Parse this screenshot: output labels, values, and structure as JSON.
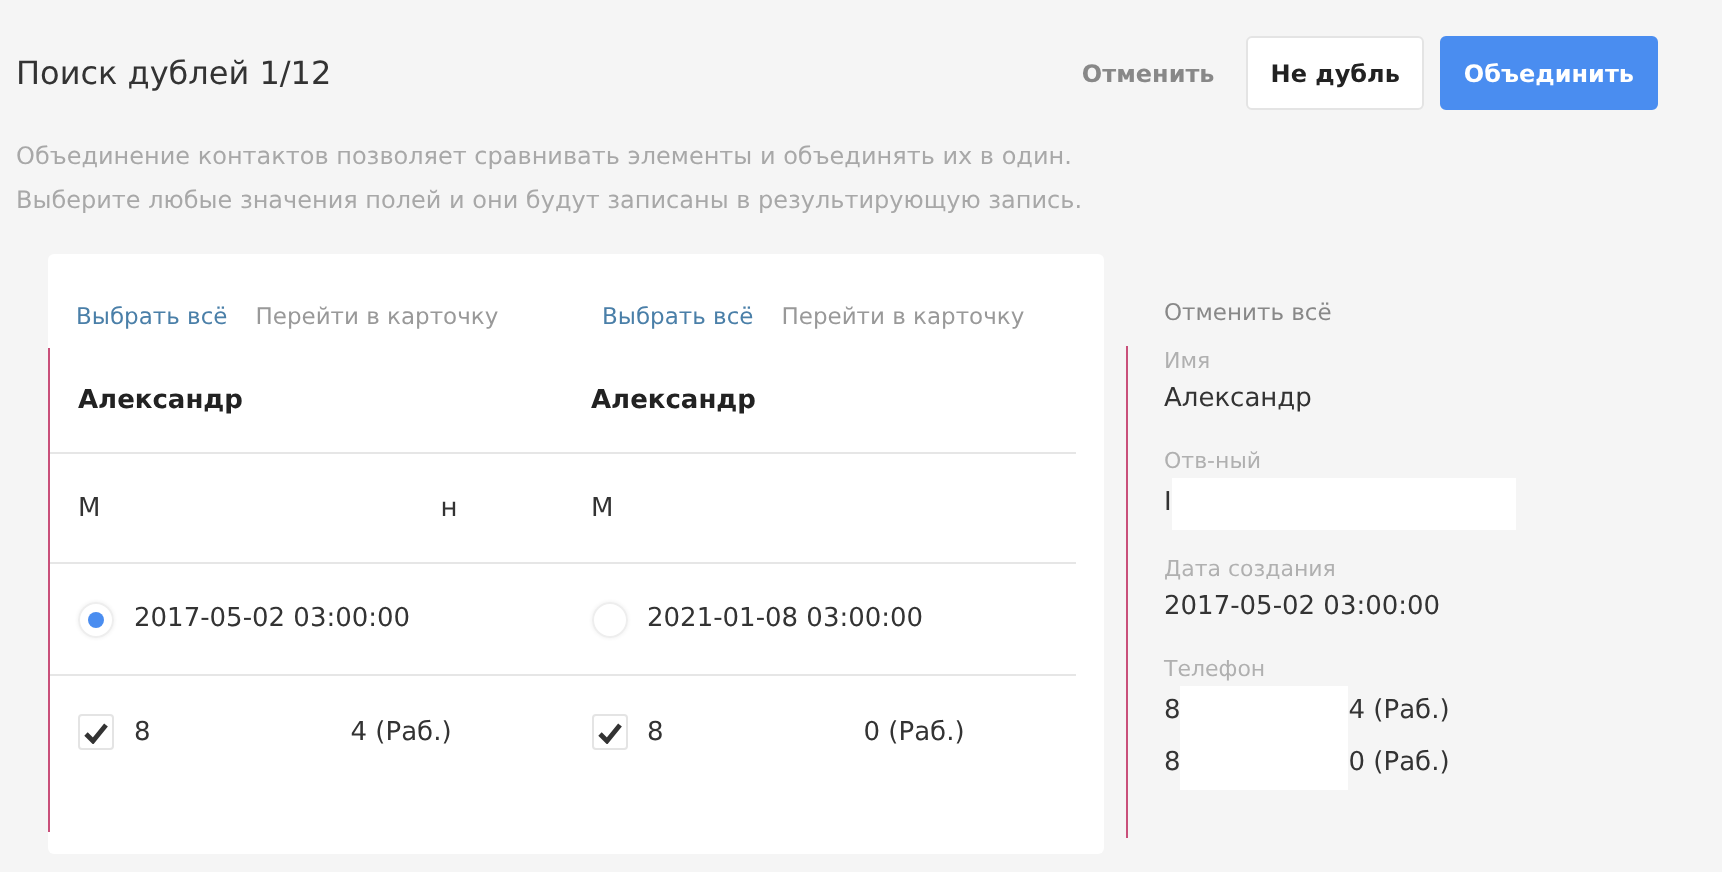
{
  "header": {
    "title": "Поиск дублей 1/12",
    "buttons": [
      {
        "label": "Отменить",
        "kind": "text"
      },
      {
        "label": "Не дубль",
        "kind": "secondary"
      },
      {
        "label": "Объединить",
        "kind": "primary"
      }
    ]
  },
  "description": [
    "Объединение контактов позволяет сравнивать элементы и объединять их в один.",
    "Выберите любые значения полей и они будут записаны в результирующую запись."
  ],
  "contacts": [
    {
      "select_all": "Выбрать всё",
      "open_card": "Перейти в карточку",
      "name": "Александр",
      "responsible": {
        "start": "М",
        "end": "н"
      },
      "created": {
        "text": "2017-05-02 03:00:00",
        "selected": true
      },
      "phone": {
        "start": "8",
        "end": "4 (Раб.)",
        "checked": true
      }
    },
    {
      "select_all": "Выбрать всё",
      "open_card": "Перейти в карточку",
      "name": "Александр",
      "responsible": {
        "start": "М"
      },
      "created": {
        "text": "2021-01-08 03:00:00",
        "selected": false
      },
      "phone": {
        "start": "8",
        "end": "0 (Раб.)",
        "checked": true
      }
    }
  ],
  "result": {
    "cancel_all": "Отменить всё",
    "fields": [
      {
        "label": "Имя",
        "values": [
          {
            "start": "Александр",
            "redacted": false
          }
        ]
      },
      {
        "label": "Отв-ный",
        "values": [
          {
            "start": "I",
            "redacted": true
          }
        ]
      },
      {
        "label": "Дата создания",
        "values": [
          {
            "start": "2017-05-02 03:00:00",
            "redacted": false
          }
        ]
      },
      {
        "label": "Телефон",
        "values": [
          {
            "start": "8",
            "end": "4 (Раб.)",
            "redacted": true
          },
          {
            "start": "8",
            "end": "0 (Раб.)",
            "redacted": true
          }
        ]
      }
    ]
  }
}
